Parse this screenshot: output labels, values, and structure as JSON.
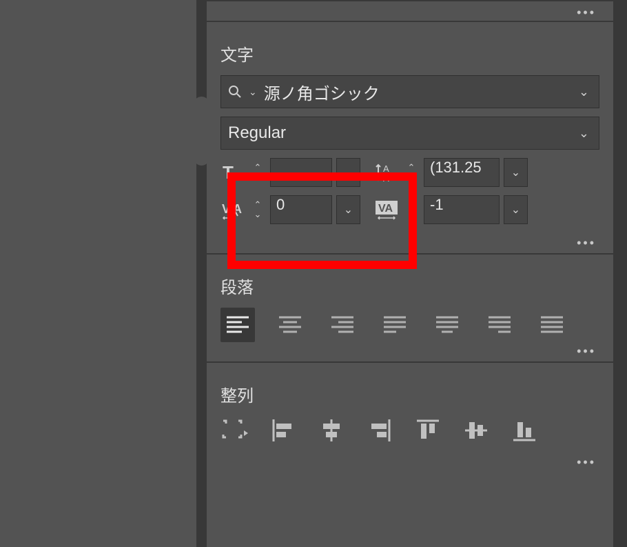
{
  "character_panel": {
    "title": "文字",
    "font_name": "源ノ角ゴシック",
    "font_weight": "Regular",
    "font_size": "",
    "leading": "(131.25",
    "kerning": "0",
    "tracking": "-1"
  },
  "paragraph_panel": {
    "title": "段落",
    "alignments": [
      "left",
      "center",
      "right",
      "justify-last-left",
      "justify-last-center",
      "justify-last-right",
      "justify-all"
    ],
    "active_alignment": "left"
  },
  "align_panel": {
    "title": "整列",
    "operations": [
      "align-to-artboard",
      "align-left",
      "align-center-h",
      "align-right",
      "align-top",
      "align-center-v",
      "align-bottom"
    ]
  }
}
